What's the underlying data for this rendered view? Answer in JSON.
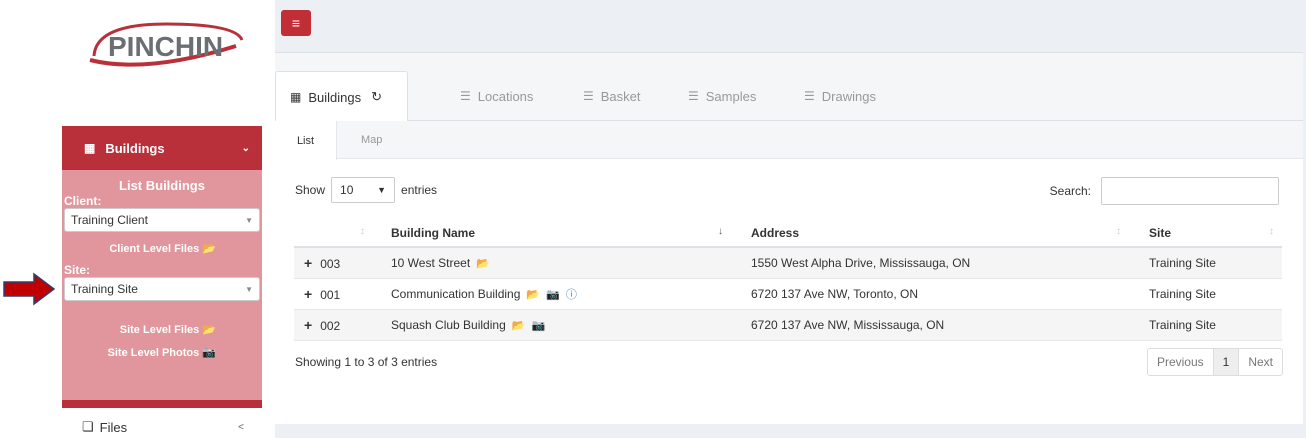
{
  "brand": {
    "logo_text": "PINCHIN",
    "accent": "#b92f3a"
  },
  "sidebar": {
    "header": "Buildings",
    "header_icon": "building-icon",
    "list_title": "List Buildings",
    "client_label": "Client:",
    "client_value": "Training Client",
    "client_files": "Client Level Files",
    "site_label": "Site:",
    "site_value": "Training Site",
    "site_files": "Site Level Files",
    "site_photos": "Site Level Photos",
    "files_item": "Files"
  },
  "tabs": [
    {
      "label": "Buildings",
      "icon": "building-icon"
    },
    {
      "label": "Locations",
      "icon": "list-icon"
    },
    {
      "label": "Basket",
      "icon": "list-icon"
    },
    {
      "label": "Samples",
      "icon": "list-icon"
    },
    {
      "label": "Drawings",
      "icon": "list-icon"
    }
  ],
  "subtabs": [
    "List",
    "Map"
  ],
  "table_controls": {
    "show_label": "Show",
    "entries_value": "10",
    "entries_label": "entries",
    "search_label": "Search:"
  },
  "table": {
    "headers": [
      "",
      "Building Name",
      "Address",
      "Site"
    ],
    "rows": [
      {
        "id": "003",
        "name": "10 West Street",
        "address": "1550 West Alpha Drive, Mississauga, ON",
        "site": "Training Site"
      },
      {
        "id": "001",
        "name": "Communication Building",
        "address": "6720 137 Ave NW, Toronto, ON",
        "site": "Training Site"
      },
      {
        "id": "002",
        "name": "Squash Club Building",
        "address": "6720 137 Ave NW, Mississauga, ON",
        "site": "Training Site"
      }
    ]
  },
  "footer": {
    "showing": "Showing 1 to 3 of 3 entries",
    "prev": "Previous",
    "page": "1",
    "next": "Next"
  }
}
